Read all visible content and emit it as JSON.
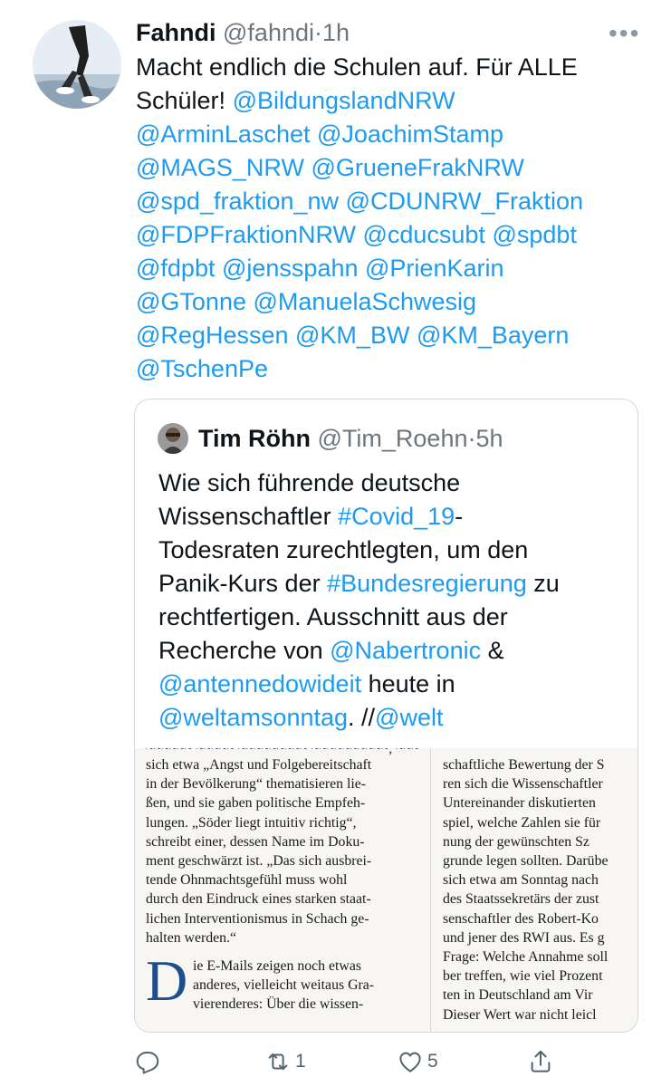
{
  "tweet": {
    "author_name": "Fahndi",
    "author_handle": "@fahndi",
    "separator": "·",
    "time": "1h",
    "more_label": "•••",
    "text_lines": [
      [
        {
          "t": "plain",
          "v": "Macht endlich die Schulen auf. Für ALLE"
        }
      ],
      [
        {
          "t": "plain",
          "v": "Schüler! "
        },
        {
          "t": "mention",
          "v": "@BildungslandNRW"
        }
      ],
      [
        {
          "t": "mention",
          "v": "@ArminLaschet"
        },
        {
          "t": "plain",
          "v": " "
        },
        {
          "t": "mention",
          "v": "@JoachimStamp"
        }
      ],
      [
        {
          "t": "mention",
          "v": "@MAGS_NRW"
        },
        {
          "t": "plain",
          "v": " "
        },
        {
          "t": "mention",
          "v": "@GrueneFrakNRW"
        }
      ],
      [
        {
          "t": "mention",
          "v": "@spd_fraktion_nw"
        },
        {
          "t": "plain",
          "v": " "
        },
        {
          "t": "mention",
          "v": "@CDUNRW_Fraktion"
        }
      ],
      [
        {
          "t": "mention",
          "v": "@FDPFraktionNRW"
        },
        {
          "t": "plain",
          "v": " "
        },
        {
          "t": "mention",
          "v": "@cducsubt"
        },
        {
          "t": "plain",
          "v": " "
        },
        {
          "t": "mention",
          "v": "@spdbt"
        }
      ],
      [
        {
          "t": "mention",
          "v": "@fdpbt"
        },
        {
          "t": "plain",
          "v": " "
        },
        {
          "t": "mention",
          "v": "@jensspahn"
        },
        {
          "t": "plain",
          "v": " "
        },
        {
          "t": "mention",
          "v": "@PrienKarin"
        }
      ],
      [
        {
          "t": "mention",
          "v": "@GTonne"
        },
        {
          "t": "plain",
          "v": " "
        },
        {
          "t": "mention",
          "v": "@ManuelaSchwesig"
        }
      ],
      [
        {
          "t": "mention",
          "v": "@RegHessen"
        },
        {
          "t": "plain",
          "v": " "
        },
        {
          "t": "mention",
          "v": "@KM_BW"
        },
        {
          "t": "plain",
          "v": " "
        },
        {
          "t": "mention",
          "v": "@KM_Bayern"
        }
      ],
      [
        {
          "t": "mention",
          "v": "@TschenPe"
        }
      ]
    ]
  },
  "quoted": {
    "author_name": "Tim Röhn",
    "author_handle": "@Tim_Roehn",
    "separator": "·",
    "time": "5h",
    "text_lines": [
      [
        {
          "t": "plain",
          "v": "Wie sich führende deutsche"
        }
      ],
      [
        {
          "t": "plain",
          "v": "Wissenschaftler "
        },
        {
          "t": "hashtag",
          "v": "#Covid_19"
        },
        {
          "t": "plain",
          "v": "-"
        }
      ],
      [
        {
          "t": "plain",
          "v": "Todesraten zurechtlegten, um den"
        }
      ],
      [
        {
          "t": "plain",
          "v": "Panik-Kurs der "
        },
        {
          "t": "hashtag",
          "v": "#Bundesregierung"
        },
        {
          "t": "plain",
          "v": " zu"
        }
      ],
      [
        {
          "t": "plain",
          "v": "rechtfertigen. Ausschnitt aus der"
        }
      ],
      [
        {
          "t": "plain",
          "v": "Recherche von "
        },
        {
          "t": "mention",
          "v": "@Nabertronic"
        },
        {
          "t": "plain",
          "v": " &"
        }
      ],
      [
        {
          "t": "mention",
          "v": "@antennedowideit"
        },
        {
          "t": "plain",
          "v": " heute in"
        }
      ],
      [
        {
          "t": "mention",
          "v": "@weltamsonntag"
        },
        {
          "t": "plain",
          "v": ". //"
        },
        {
          "t": "mention",
          "v": "@welt"
        }
      ]
    ],
    "newspaper": {
      "col1_lines": [
        "sich etwa „Angst und Folgebereitschaft",
        "in der Bevölkerung“ thematisieren lie-",
        "ßen, und sie gaben politische Empfeh-",
        "lungen. „Söder liegt intuitiv richtig“,",
        "schreibt einer, dessen Name im Doku-",
        "ment geschwärzt ist. „Das sich ausbrei-",
        "tende Ohnmachtsgefühl muss wohl",
        "durch den Eindruck eines starken staat-",
        "lichen Interventionismus in Schach ge-",
        "halten werden.“"
      ],
      "dropcap": "D",
      "para2_lines": [
        "ie E-Mails zeigen noch etwas",
        "anderes, vielleicht weitaus Gra-",
        "vierenderes: Über die wissen-"
      ],
      "col2_lines": [
        "schaftliche Bewertung der S",
        "ren sich die Wissenschaftler",
        "Untereinander diskutierten",
        "spiel, welche Zahlen sie für",
        "nung der gewünschten Sz",
        "grunde legen sollten. Darübe",
        "sich etwa am Sonntag nach",
        "des Staatssekretärs der zust",
        "senschaftler des Robert-Ko",
        "und jener des RWI aus. Es g",
        "Frage: Welche Annahme soll",
        "ber treffen, wie viel Prozent",
        "ten in Deutschland am Vir",
        "Dieser Wert war nicht leicl"
      ]
    }
  },
  "actions": {
    "reply_count": "",
    "retweet_count": "1",
    "like_count": "5",
    "share_count": ""
  },
  "colors": {
    "link": "#1d9bf0",
    "secondary_text": "#6e767d",
    "border": "#cfd9de",
    "dropcap": "#1f4e8c"
  }
}
